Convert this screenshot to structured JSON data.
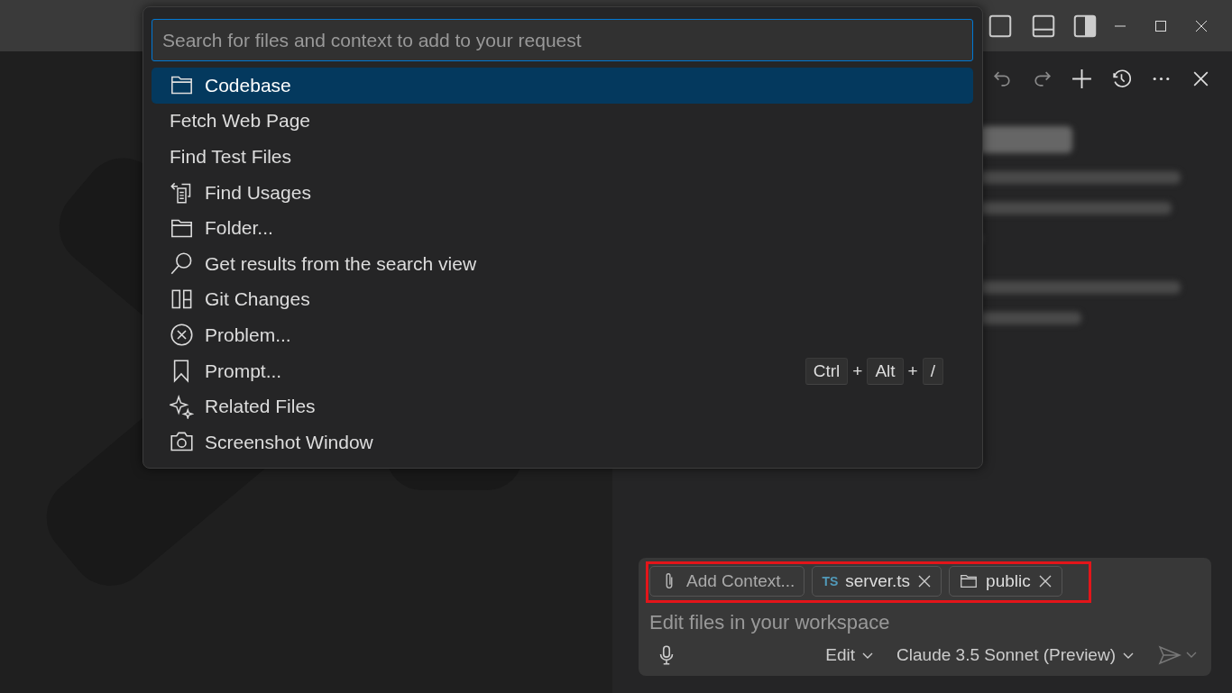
{
  "quick_pick": {
    "placeholder": "Search for files and context to add to your request",
    "items": [
      {
        "label": "Codebase",
        "kind": "folder",
        "selected": true
      },
      {
        "label": "Fetch Web Page",
        "kind": "plain",
        "selected": false
      },
      {
        "label": "Find Test Files",
        "kind": "plain",
        "selected": false
      },
      {
        "label": "Find Usages",
        "kind": "references",
        "selected": false
      },
      {
        "label": "Folder...",
        "kind": "folder",
        "selected": false
      },
      {
        "label": "Get results from the search view",
        "kind": "search",
        "selected": false
      },
      {
        "label": "Git Changes",
        "kind": "git",
        "selected": false
      },
      {
        "label": "Problem...",
        "kind": "error",
        "selected": false
      },
      {
        "label": "Prompt...",
        "kind": "bookmark",
        "selected": false,
        "keybinding": {
          "keys": [
            "Ctrl",
            "Alt",
            "/"
          ],
          "separator": "+"
        }
      },
      {
        "label": "Related Files",
        "kind": "sparkle",
        "selected": false
      },
      {
        "label": "Screenshot Window",
        "kind": "camera",
        "selected": false
      }
    ]
  },
  "chat": {
    "chips": [
      {
        "kind": "add",
        "label": "Add Context..."
      },
      {
        "kind": "file",
        "badge": "TS",
        "label": "server.ts"
      },
      {
        "kind": "folder",
        "label": "public"
      }
    ],
    "placeholder": "Edit files in your workspace",
    "mode": "Edit",
    "model": "Claude 3.5 Sonnet (Preview)"
  }
}
